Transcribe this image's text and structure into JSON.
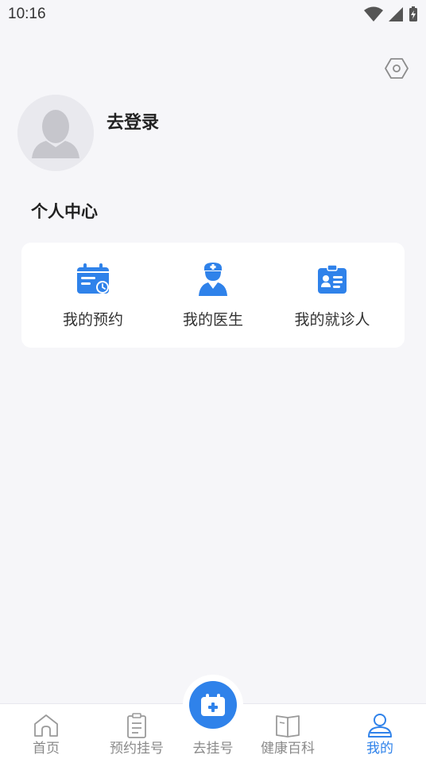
{
  "status_bar": {
    "time": "10:16",
    "icons": [
      "wifi-icon",
      "signal-icon",
      "battery-charging-icon"
    ]
  },
  "header": {
    "settings_icon": "settings-hexagon-icon"
  },
  "profile": {
    "login_label": "去登录",
    "avatar_icon": "default-avatar-icon"
  },
  "section": {
    "title": "个人中心"
  },
  "menu": {
    "items": [
      {
        "label": "我的预约",
        "icon": "calendar-clock-icon"
      },
      {
        "label": "我的医生",
        "icon": "doctor-icon"
      },
      {
        "label": "我的就诊人",
        "icon": "patient-card-icon"
      }
    ]
  },
  "tabbar": {
    "tabs": [
      {
        "label": "首页",
        "icon": "home-icon"
      },
      {
        "label": "预约挂号",
        "icon": "clipboard-icon"
      },
      {
        "label": "去挂号",
        "icon": "calendar-plus-icon"
      },
      {
        "label": "健康百科",
        "icon": "book-icon"
      },
      {
        "label": "我的",
        "icon": "user-icon"
      }
    ],
    "active_index": 4
  },
  "colors": {
    "accent": "#2f82ea",
    "inactive": "#8a8a8a",
    "background": "#f6f6f9"
  }
}
